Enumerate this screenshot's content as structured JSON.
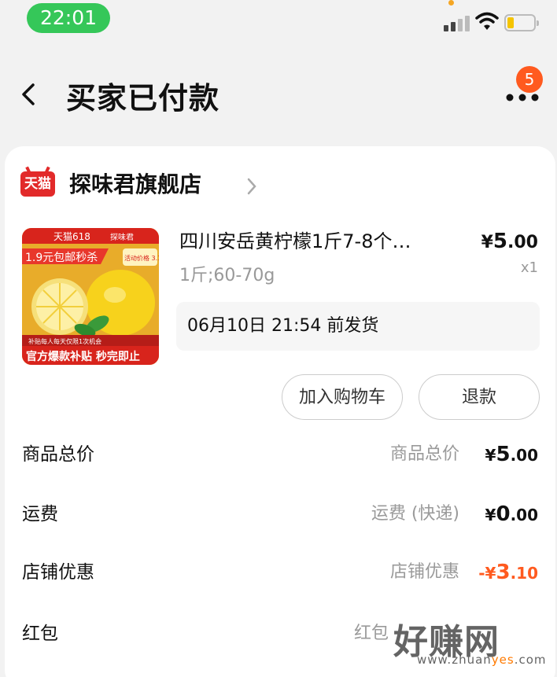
{
  "status_bar": {
    "time": "22:01"
  },
  "nav": {
    "title": "买家已付款",
    "more_badge": "5"
  },
  "store": {
    "badge": "天猫",
    "name": "探味君旗舰店"
  },
  "product": {
    "image_texts": {
      "brand": "天猫618",
      "shop": "探味君",
      "promo": "1.9元包邮秒杀",
      "tag": "活动价格 3.1元",
      "banner": "官方爆款补贴 秒完即止",
      "note": "补贴每人每天仅限1次机会"
    },
    "title": "四川安岳黄柠檬1斤7-8个…",
    "price_symbol": "¥",
    "price_int": "5",
    "price_dec": ".00",
    "spec": "1斤;60-70g",
    "qty": "x1",
    "ship_note": "06月10日 21:54 前发货"
  },
  "actions": {
    "add_cart": "加入购物车",
    "refund": "退款"
  },
  "fees": [
    {
      "label": "商品总价",
      "sub": "商品总价",
      "prefix": "¥",
      "int": "5",
      "dec": ".00",
      "discount": false
    },
    {
      "label": "运费",
      "sub": "运费 (快递)",
      "prefix": "¥",
      "int": "0",
      "dec": ".00",
      "discount": false
    },
    {
      "label": "店铺优惠",
      "sub": "店铺优惠",
      "prefix": "-¥",
      "int": "3",
      "dec": ".10",
      "discount": true
    },
    {
      "label": "红包",
      "sub": "红包",
      "prefix": "",
      "int": "",
      "dec": "",
      "discount": true
    }
  ],
  "watermark": {
    "text": "好赚网",
    "url_pre": "www.zhuan",
    "url_hl": "yes",
    "url_post": ".com"
  }
}
